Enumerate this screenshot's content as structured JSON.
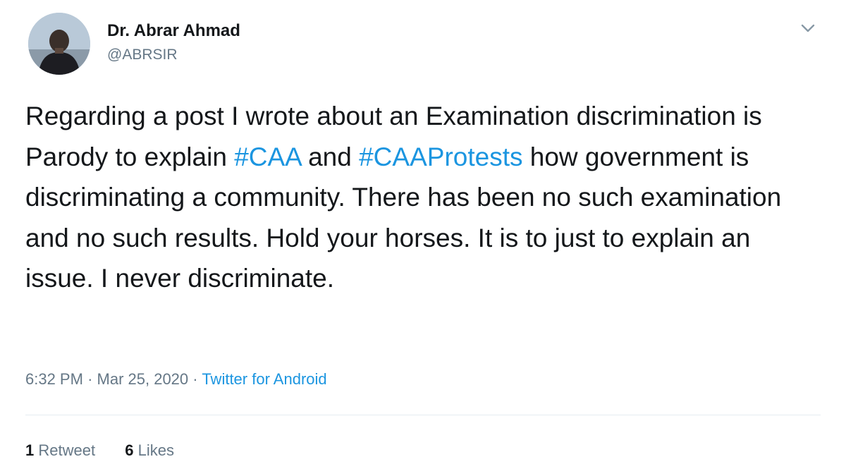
{
  "author": {
    "display_name": "Dr. Abrar Ahmad",
    "handle": "@ABRSIR"
  },
  "menu_icon": "chevron-down-icon",
  "tweet": {
    "segments": [
      {
        "text": "Regarding a post I wrote about an Examination discrimination is Parody to explain ",
        "hashtag": false
      },
      {
        "text": "#CAA",
        "hashtag": true
      },
      {
        "text": " and ",
        "hashtag": false
      },
      {
        "text": "#CAAProtests",
        "hashtag": true
      },
      {
        "text": " how government is discriminating a community. There has been no such examination and no such results. Hold your horses. It is to just to explain an issue. I never discriminate.",
        "hashtag": false
      }
    ]
  },
  "meta": {
    "time": "6:32 PM",
    "date": "Mar 25, 2020",
    "separator": "·",
    "source": "Twitter for Android"
  },
  "stats": {
    "retweets_count": "1",
    "retweets_label": "Retweet",
    "likes_count": "6",
    "likes_label": "Likes"
  },
  "colors": {
    "link": "#1b95e0",
    "secondary_text": "#657786",
    "primary_text": "#14171a"
  }
}
